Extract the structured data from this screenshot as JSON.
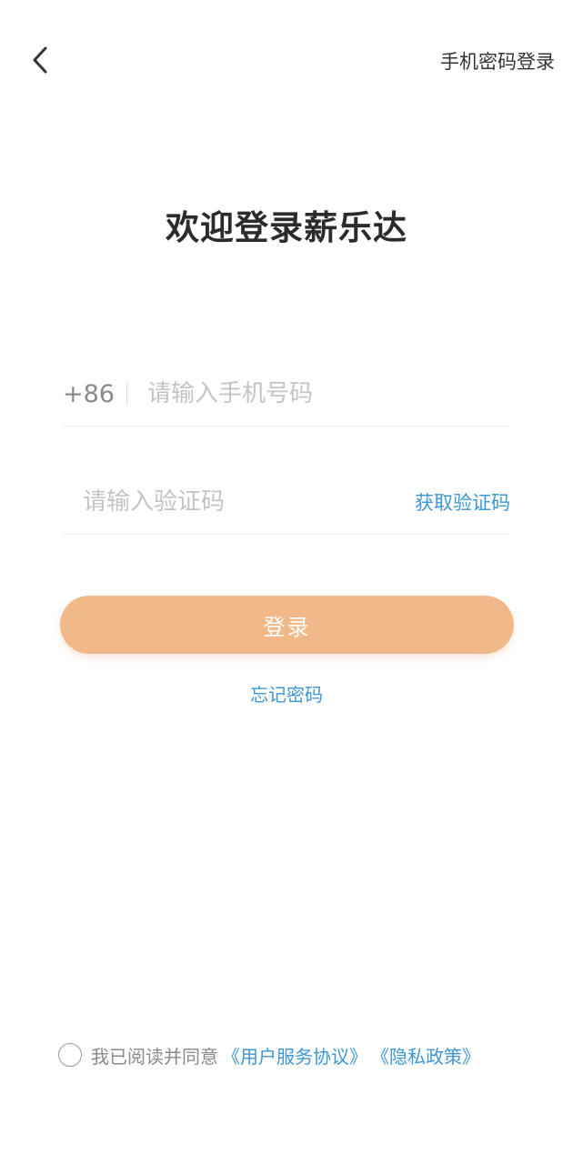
{
  "header": {
    "back_icon": "chevron-left-icon",
    "password_login_label": "手机密码登录"
  },
  "main": {
    "title": "欢迎登录薪乐达",
    "phone": {
      "country_code": "+86",
      "value": "",
      "placeholder": "请输入手机号码"
    },
    "code": {
      "value": "",
      "placeholder": "请输入验证码",
      "get_code_label": "获取验证码"
    },
    "login_label": "登录",
    "forgot_password_label": "忘记密码"
  },
  "agreement": {
    "checked": false,
    "prefix": "我已阅读并同意",
    "user_agreement_label": "《用户服务协议》",
    "privacy_policy_label": "《隐私政策》"
  },
  "colors": {
    "accent": "#3d97d3",
    "button": "#f1b98a",
    "title": "#2b2b2b",
    "placeholder": "#c4c4c4"
  }
}
